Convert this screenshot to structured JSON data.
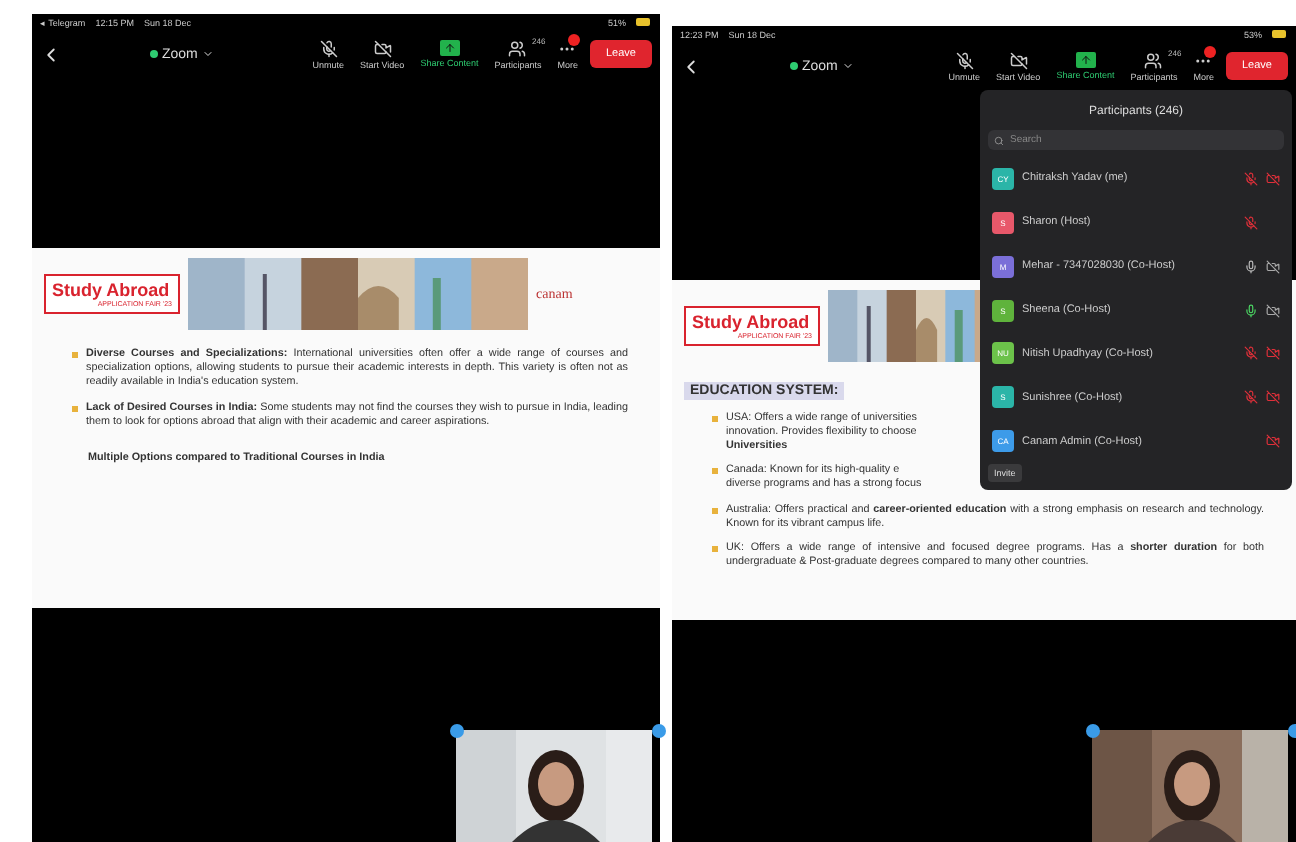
{
  "screens": [
    {
      "status_bar": {
        "app": "◂ Telegram",
        "time": "12:15 PM",
        "date": "Sun 18 Dec",
        "battery": "51%"
      },
      "toolbar": {
        "title": "Zoom",
        "buttons": [
          {
            "kind": "mic",
            "label": "Unmute"
          },
          {
            "kind": "video",
            "label": "Start Video"
          },
          {
            "kind": "share",
            "label": "Share Content"
          },
          {
            "kind": "participants",
            "label": "Participants",
            "count": "246"
          },
          {
            "kind": "more",
            "label": "More",
            "badge": true
          }
        ],
        "leave": "Leave"
      },
      "slide": {
        "logo_title": "Study Abroad",
        "logo_subtitle": "APPLICATION FAIR '23",
        "brand": "canam",
        "bullets": [
          {
            "text": "**Diverse Courses and Specializations:** International universities often offer a wide range of courses and specialization options, allowing students to pursue their academic interests in depth. This variety is often not as readily available in India's education system."
          },
          {
            "text": "**Lack of Desired Courses in India:** Some students may not find the courses they wish to pursue in India, leading them to look for options abroad that align with their academic and career aspirations."
          }
        ],
        "footer": "Multiple Options compared to Traditional Courses in India"
      }
    },
    {
      "status_bar": {
        "time": "12:23 PM",
        "date": "Sun 18 Dec",
        "battery": "53%"
      },
      "toolbar": {
        "title": "Zoom",
        "buttons": [
          {
            "kind": "mic",
            "label": "Unmute"
          },
          {
            "kind": "video",
            "label": "Start Video"
          },
          {
            "kind": "share",
            "label": "Share Content"
          },
          {
            "kind": "participants",
            "label": "Participants",
            "count": "246"
          },
          {
            "kind": "more",
            "label": "More",
            "badge": true
          }
        ],
        "leave": "Leave"
      },
      "slide": {
        "logo_title": "Study Abroad",
        "logo_subtitle": "APPLICATION FAIR '23",
        "heading": "EDUCATION SYSTEM:",
        "bullets": [
          {
            "lines": [
              "USA: Offers a wide range of universities",
              "innovation. Provides flexibility to choose",
              "**Universities**"
            ]
          },
          {
            "lines": [
              "Canada: Known for its high-quality e",
              "diverse programs and has a strong focus"
            ]
          },
          {
            "text": "Australia: Offers practical and **career-oriented education** with a strong emphasis on research and technology. Known for its vibrant campus life."
          },
          {
            "text": "UK: Offers a wide range of intensive and focused degree programs. Has a **shorter duration** for both undergraduate & Post-graduate degrees compared to many other countries."
          }
        ]
      },
      "participants_panel": {
        "title": "Participants (246)",
        "search": {
          "placeholder": "Search"
        },
        "participants": [
          {
            "initials": "CY",
            "name": "Chitraksh Yadav (me)",
            "color": "#2bb5a8",
            "muted": true,
            "talking": false,
            "camera_blocked": true
          },
          {
            "initials": "S",
            "name": "Sharon (Host)",
            "color": "#e8586a",
            "muted": true,
            "talking": false
          },
          {
            "initials": "M",
            "name": "Mehar - 7347028030 (Co-Host)",
            "color": "#7b6fd8",
            "muted": false,
            "talking": false,
            "camera_blocked": false
          },
          {
            "initials": "S",
            "name": "Sheena (Co-Host)",
            "color": "#5fb33c",
            "muted": false,
            "talking": true,
            "camera_blocked": false
          },
          {
            "initials": "NU",
            "name": "Nitish Upadhyay (Co-Host)",
            "color": "#6cc24a",
            "muted": true,
            "talking": false,
            "camera_blocked": true
          },
          {
            "initials": "S",
            "name": "Sunishree (Co-Host)",
            "color": "#2bb5a8",
            "muted": true,
            "talking": false,
            "camera_blocked": true
          },
          {
            "initials": "CA",
            "name": "Canam Admin (Co-Host)",
            "color": "#3d9be9",
            "camera_blocked": true
          }
        ],
        "invite": "Invite"
      }
    }
  ]
}
